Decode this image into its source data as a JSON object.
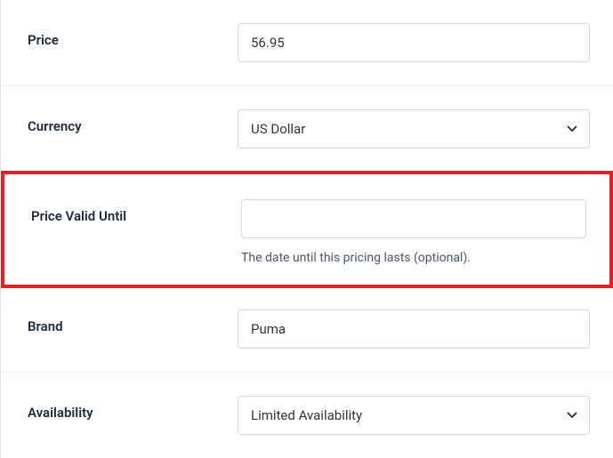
{
  "fields": {
    "price": {
      "label": "Price",
      "value": "56.95"
    },
    "currency": {
      "label": "Currency",
      "value": "US Dollar"
    },
    "price_valid_until": {
      "label": "Price Valid Until",
      "value": "",
      "help": "The date until this pricing lasts (optional)."
    },
    "brand": {
      "label": "Brand",
      "value": "Puma"
    },
    "availability": {
      "label": "Availability",
      "value": "Limited Availability"
    }
  }
}
